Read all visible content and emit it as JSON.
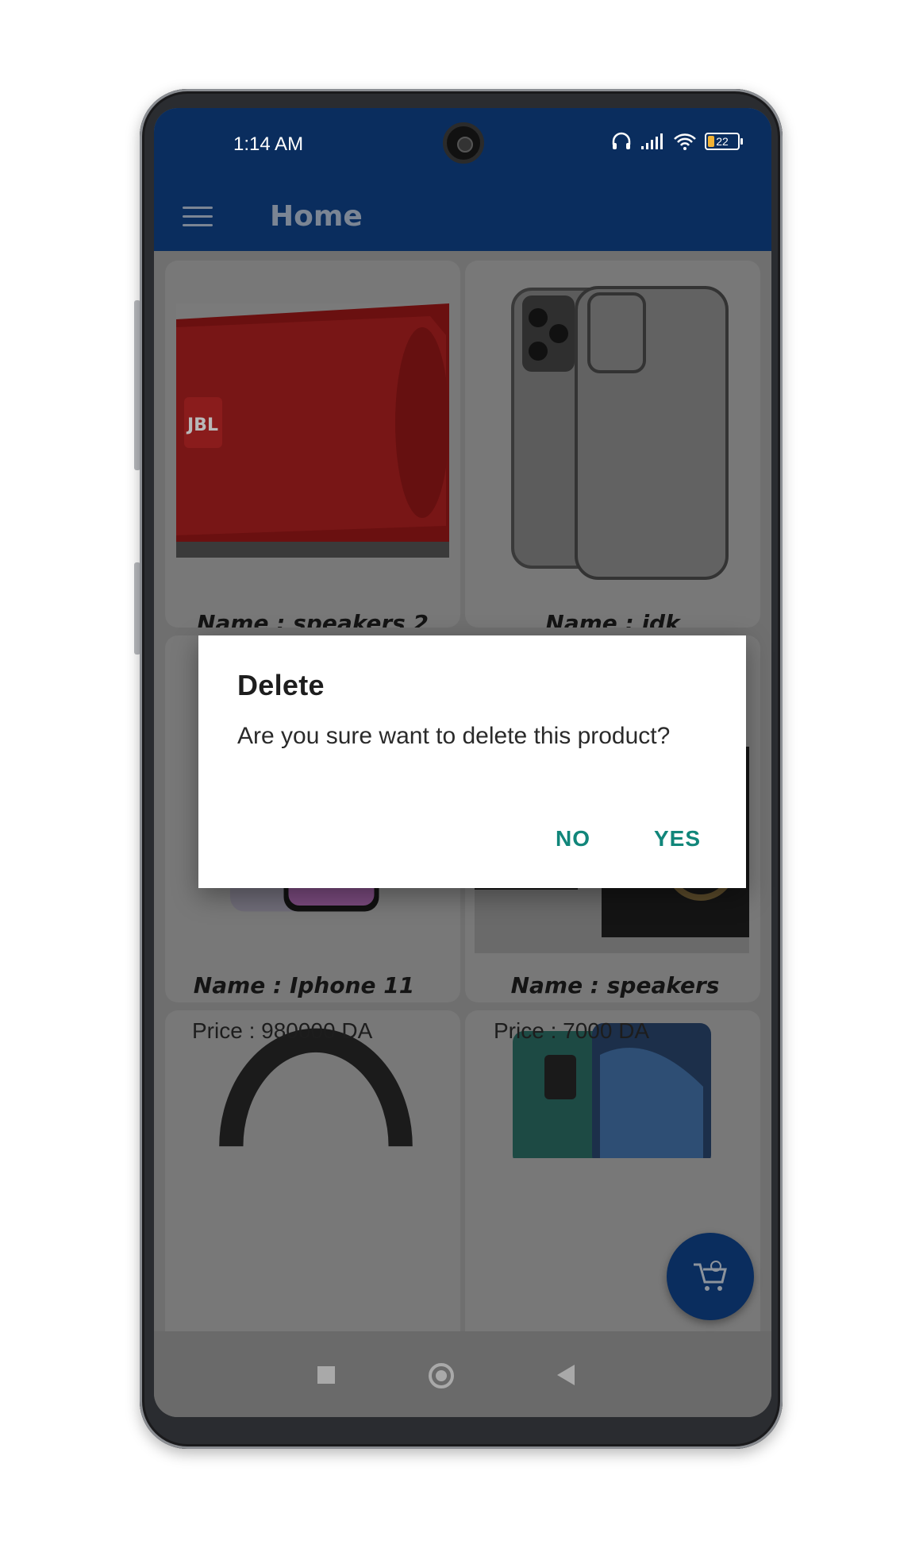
{
  "status_bar": {
    "time": "1:14 AM",
    "battery": "22"
  },
  "toolbar": {
    "title": "Home"
  },
  "products": [
    {
      "name": "Name : speakers 2",
      "price": ""
    },
    {
      "name": "Name : idk",
      "price": ""
    },
    {
      "name": "Name : Iphone 11",
      "price": "Price : 980000 DA"
    },
    {
      "name": "Name : speakers",
      "price": "Price : 7000 DA"
    },
    {
      "name": "",
      "price": ""
    },
    {
      "name": "",
      "price": ""
    }
  ],
  "dialog": {
    "title": "Delete",
    "message": "Are you sure want to delete this product?",
    "no_label": "NO",
    "yes_label": "YES"
  },
  "colors": {
    "app_bar": "#0a2d5e",
    "dialog_accent": "#11867a"
  }
}
